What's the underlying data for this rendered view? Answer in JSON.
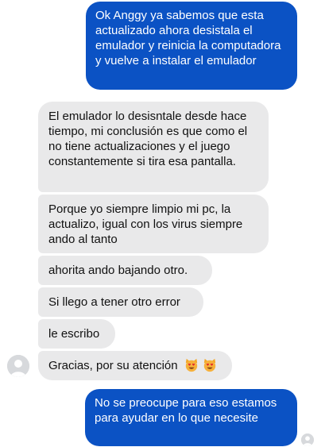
{
  "conversation": {
    "messages": [
      {
        "direction": "outgoing",
        "text": "Ok Anggy ya sabemos que esta actualizado ahora desistala el emulador y reinicia la computadora y vuelve a instalar el emulador"
      },
      {
        "direction": "incoming",
        "text": "El emulador lo desisntale desde hace tiempo, mi conclusión es que como el no tiene actualizaciones y el juego constantemente si tira esa pantalla."
      },
      {
        "direction": "incoming",
        "text": "Porque yo siempre limpio mi pc, la actualizo, igual con los virus siempre ando al tanto"
      },
      {
        "direction": "incoming",
        "text": "ahorita ando bajando otro."
      },
      {
        "direction": "incoming",
        "text": "Si llego a tener otro error"
      },
      {
        "direction": "incoming",
        "text": "le escribo"
      },
      {
        "direction": "incoming",
        "text": "Gracias, por su atención",
        "emojis": [
          "smiling-cat-heart-eyes",
          "smiling-cat-heart-eyes"
        ]
      },
      {
        "direction": "outgoing",
        "text": "No se preocupe para eso estamos para ayudar en lo que necesite"
      }
    ]
  },
  "colors": {
    "outgoing_bubble": "#0b52c4",
    "incoming_bubble": "#e9e9ea",
    "avatar_placeholder": "#d7d9dc"
  }
}
